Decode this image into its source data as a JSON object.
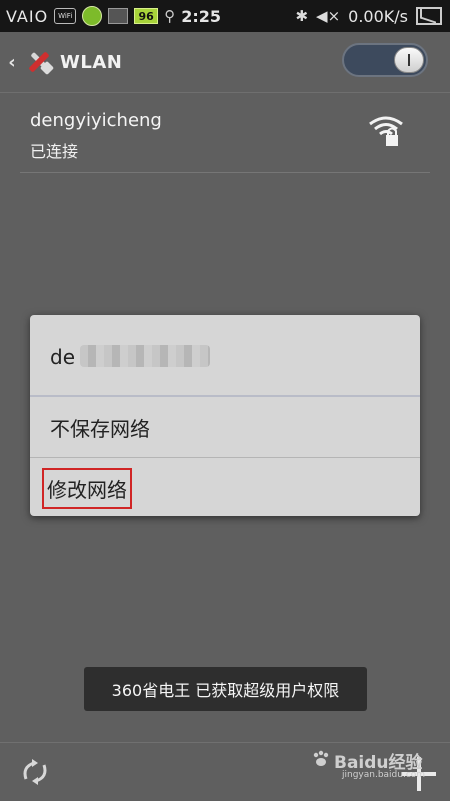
{
  "status_bar": {
    "brand": "VAIO",
    "wifi_badge": "WiFi",
    "battery_level": "96",
    "time": "2:25",
    "net_speed": "0.00K/s"
  },
  "action_bar": {
    "title": "WLAN",
    "wlan_enabled": true
  },
  "network": {
    "ssid": "dengyiyicheng",
    "status": "已连接"
  },
  "dialog": {
    "title_visible": "de",
    "items": [
      {
        "label": "不保存网络"
      },
      {
        "label": "修改网络"
      }
    ]
  },
  "toast": {
    "text": "360省电王 已获取超级用户权限"
  },
  "watermark": {
    "main": "Baidu经验",
    "sub": "jingyan.baidu.com"
  },
  "colors": {
    "background": "#5f5f5f",
    "dialog": "#d6d6d6",
    "highlight": "#d02525",
    "toggle": "#3d4a5d"
  }
}
